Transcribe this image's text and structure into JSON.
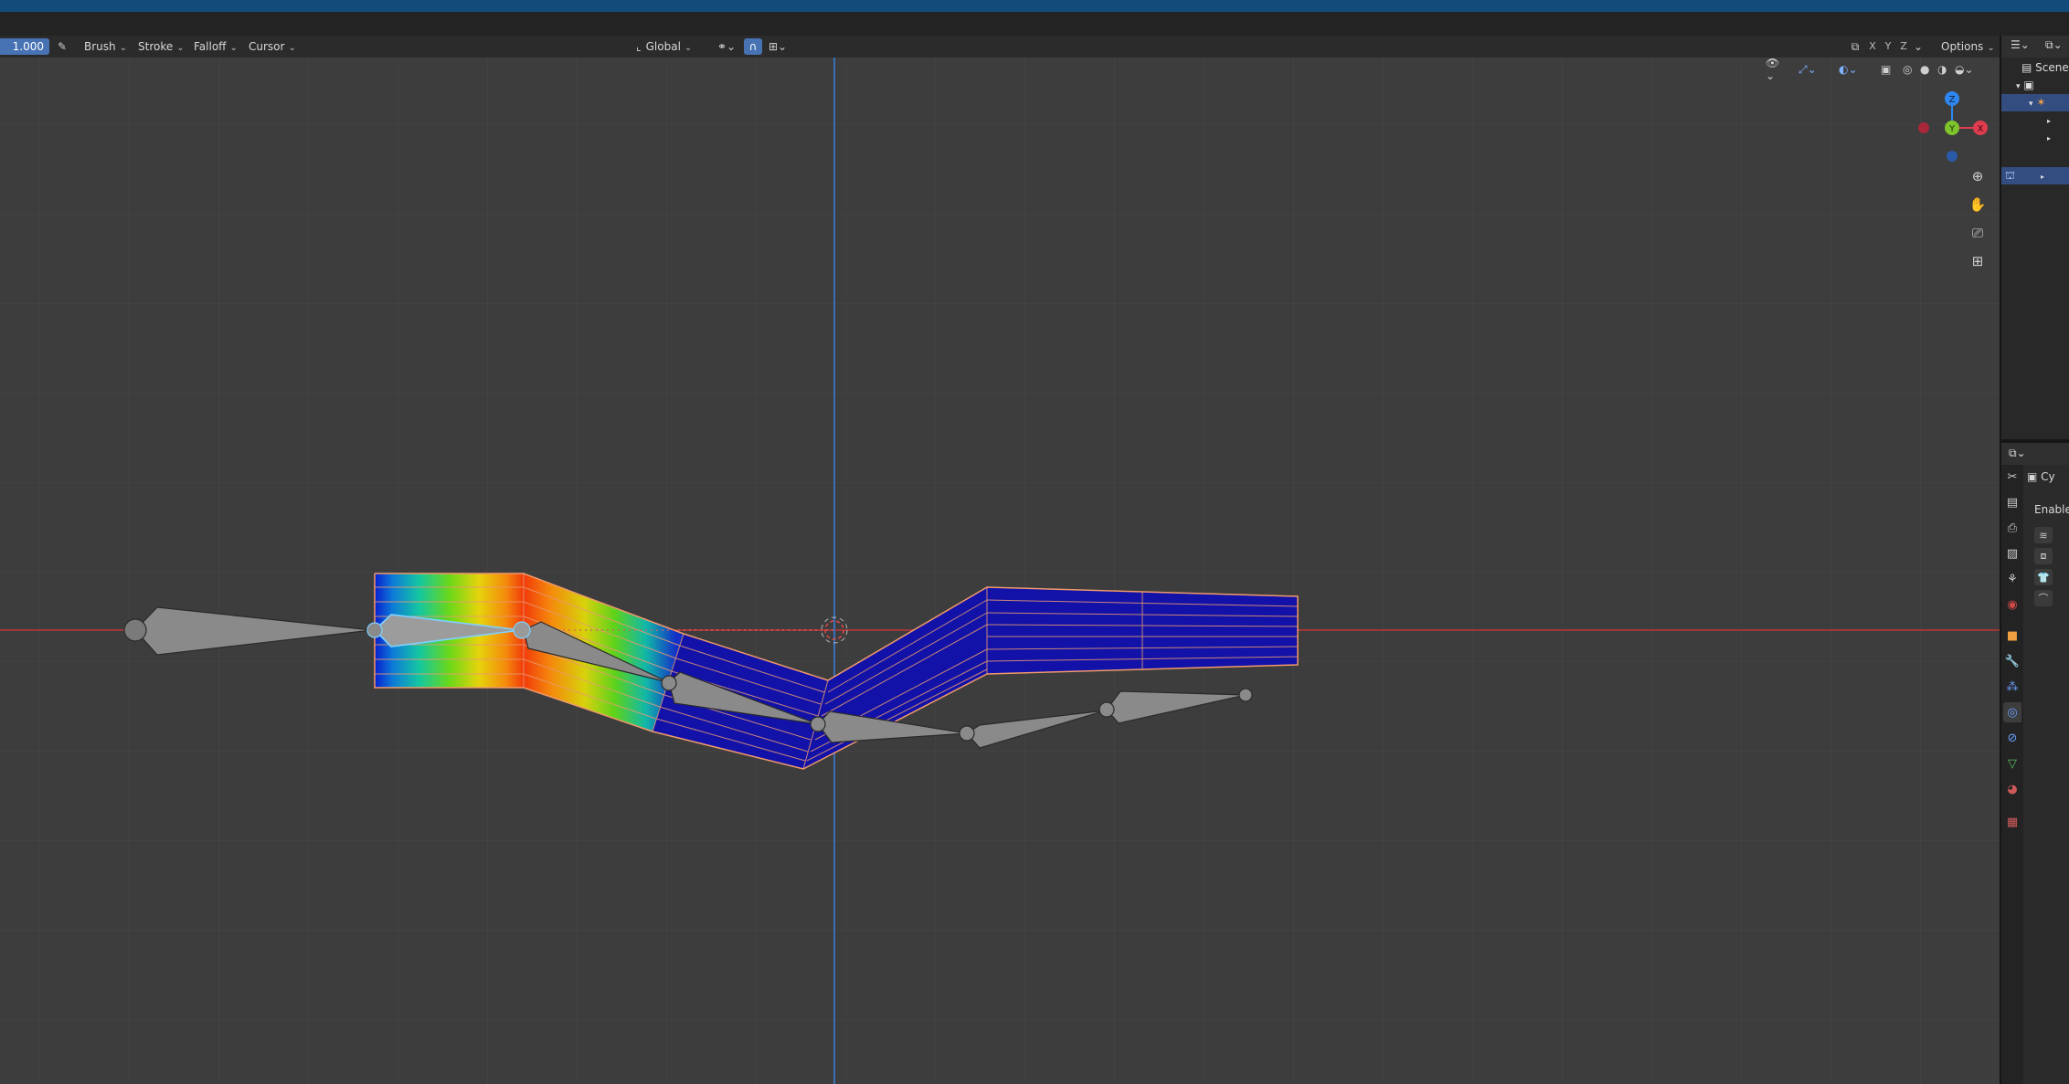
{
  "header": {
    "strength_value": "1.000",
    "brush_label": "Brush",
    "stroke_label": "Stroke",
    "falloff_label": "Falloff",
    "cursor_label": "Cursor",
    "orientation_label": "Global",
    "axis_x": "X",
    "axis_y": "Y",
    "axis_z": "Z",
    "options_label": "Options"
  },
  "gizmo": {
    "z_label": "Z",
    "y_label": "Y",
    "x_label": "X",
    "x_color": "#e03c4f",
    "y_color": "#7ec42b",
    "z_color": "#2e87ef"
  },
  "outliner": {
    "scene_label": "Scene"
  },
  "properties": {
    "object_name": "Cy",
    "enable_label": "Enable"
  },
  "colors": {
    "accent": "#4772b3",
    "viewport_bg": "#3d3d3d",
    "x_axis_line": "#b03a3a",
    "y_axis_line": "#3a6fb8",
    "mesh_wire": "#f0a070"
  },
  "icons": {
    "brush_tool": "pencil-icon",
    "snap": "magnet-icon",
    "proportional": "circle-target-icon",
    "zoom": "magnifier-icon",
    "pan": "hand-icon",
    "camera": "camera-icon",
    "ortho": "grid-icon"
  }
}
